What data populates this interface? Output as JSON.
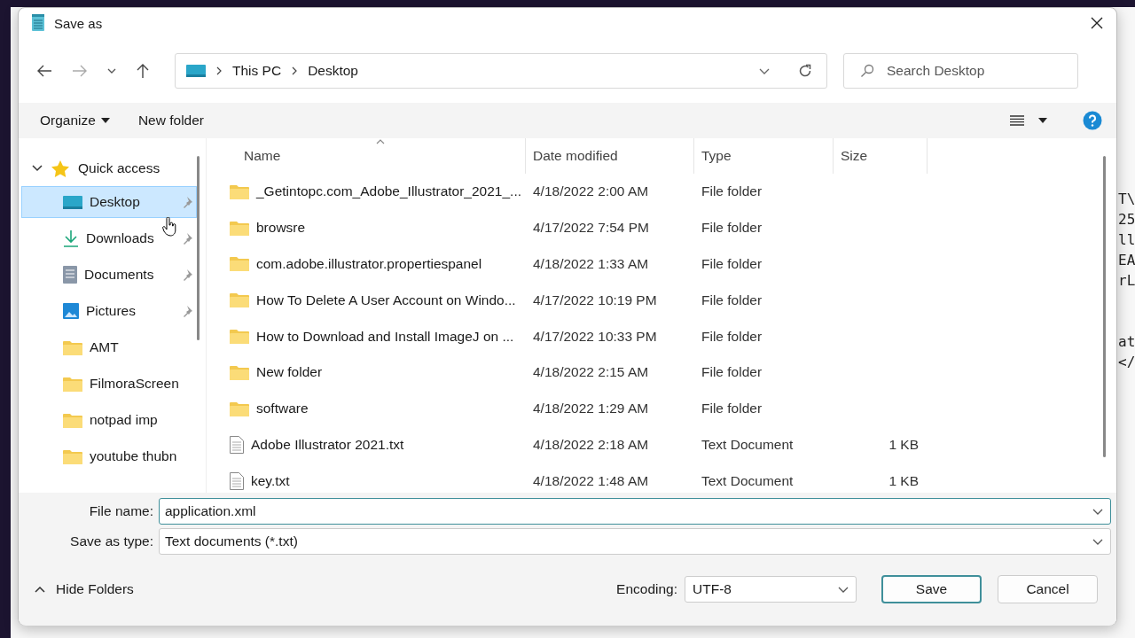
{
  "window": {
    "title": "Save as"
  },
  "address": {
    "segments": [
      "This PC",
      "Desktop"
    ]
  },
  "search": {
    "placeholder": "Search Desktop"
  },
  "toolbar": {
    "organize": "Organize",
    "new_folder": "New folder"
  },
  "sidebar": {
    "group": {
      "label": "Quick access",
      "expanded": true,
      "children": [
        {
          "label": "Desktop",
          "kind": "desktop",
          "pinned": true,
          "selected": true
        },
        {
          "label": "Downloads",
          "kind": "download",
          "pinned": true,
          "selected": false
        },
        {
          "label": "Documents",
          "kind": "document",
          "pinned": true,
          "selected": false
        },
        {
          "label": "Pictures",
          "kind": "picture",
          "pinned": true,
          "selected": false
        },
        {
          "label": "AMT",
          "kind": "folder",
          "pinned": false,
          "selected": false
        },
        {
          "label": "FilmoraScreen",
          "kind": "folder",
          "pinned": false,
          "selected": false
        },
        {
          "label": "notpad imp",
          "kind": "folder",
          "pinned": false,
          "selected": false
        },
        {
          "label": "youtube thubn",
          "kind": "folder",
          "pinned": false,
          "selected": false
        }
      ]
    }
  },
  "table": {
    "columns": [
      "Name",
      "Date modified",
      "Type",
      "Size"
    ],
    "rows": [
      {
        "kind": "folder",
        "name": "_Getintopc.com_Adobe_Illustrator_2021_...",
        "date": "4/18/2022 2:00 AM",
        "type": "File folder"
      },
      {
        "kind": "folder",
        "name": "browsre",
        "date": "4/17/2022 7:54 PM",
        "type": "File folder"
      },
      {
        "kind": "folder",
        "name": "com.adobe.illustrator.propertiespanel",
        "date": "4/18/2022 1:33 AM",
        "type": "File folder"
      },
      {
        "kind": "folder",
        "name": "How To Delete A User Account on Windo...",
        "date": "4/17/2022 10:19 PM",
        "type": "File folder"
      },
      {
        "kind": "folder",
        "name": "How to Download and Install ImageJ on ...",
        "date": "4/17/2022 10:33 PM",
        "type": "File folder"
      },
      {
        "kind": "folder",
        "name": "New folder",
        "date": "4/18/2022 2:15 AM",
        "type": "File folder"
      },
      {
        "kind": "folder",
        "name": "software",
        "date": "4/18/2022 1:29 AM",
        "type": "File folder"
      },
      {
        "kind": "text",
        "name": "Adobe Illustrator 2021.txt",
        "date": "4/18/2022 2:18 AM",
        "type": "Text Document",
        "size": "1 KB"
      },
      {
        "kind": "text",
        "name": "key.txt",
        "date": "4/18/2022 1:48 AM",
        "type": "Text Document",
        "size": "1 KB"
      }
    ]
  },
  "file_name": {
    "label": "File name:",
    "value": "application.xml"
  },
  "save_as_type": {
    "label": "Save as type:",
    "value": "Text documents (*.txt)"
  },
  "footer": {
    "hide_folders": "Hide Folders",
    "encoding_label": "Encoding:",
    "encoding": "UTF-8",
    "buttons": [
      "Save",
      "Cancel"
    ]
  },
  "background_editor": {
    "blocks": [
      [
        "T\\",
        "25",
        "ll",
        "EA",
        "rL"
      ],
      [
        "at",
        "</"
      ]
    ]
  }
}
